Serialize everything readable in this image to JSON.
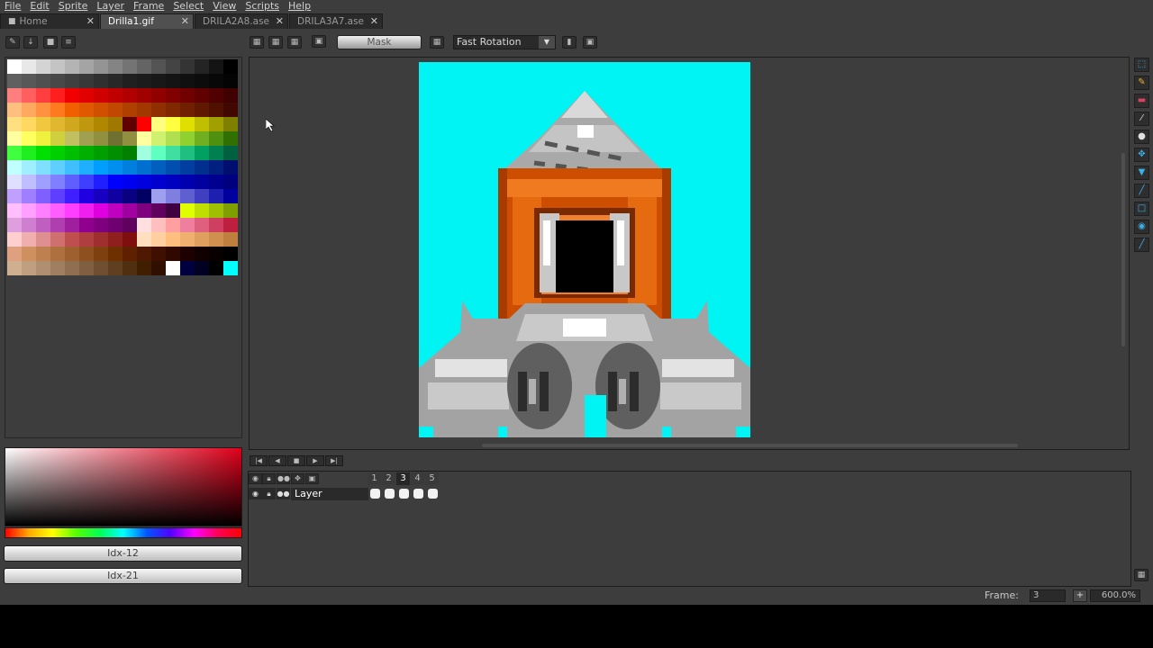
{
  "menu": [
    "File",
    "Edit",
    "Sprite",
    "Layer",
    "Frame",
    "Select",
    "View",
    "Scripts",
    "Help"
  ],
  "tabs": [
    {
      "label": "Home",
      "active": false
    },
    {
      "label": "Drilla1.gif",
      "active": true
    },
    {
      "label": "DRILA2A8.ase",
      "active": false
    },
    {
      "label": "DRILA3A7.ase",
      "active": false
    }
  ],
  "toolbar": {
    "mask_label": "Mask",
    "rotation_value": "Fast Rotation",
    "icons": [
      "grid-icon",
      "pixel-grid-icon",
      "symmetry-icon",
      "image-icon"
    ]
  },
  "palette": {
    "colors": [
      "#ffffff",
      "#e8e8e8",
      "#d4d4d4",
      "#c4c4c4",
      "#b4b4b4",
      "#a4a4a4",
      "#949494",
      "#848484",
      "#747474",
      "#646464",
      "#545454",
      "#444444",
      "#343434",
      "#242424",
      "#141414",
      "#000000",
      "#606060",
      "#585858",
      "#505050",
      "#484848",
      "#404040",
      "#383838",
      "#303030",
      "#282828",
      "#202020",
      "#1c1c1c",
      "#181818",
      "#141414",
      "#101010",
      "#0c0c0c",
      "#080808",
      "#040404",
      "#ff7f7f",
      "#ff5f5f",
      "#ff3f3f",
      "#ff1f1f",
      "#f00000",
      "#e00000",
      "#d00000",
      "#c00000",
      "#b00000",
      "#a00000",
      "#900000",
      "#800000",
      "#700000",
      "#600000",
      "#500000",
      "#400000",
      "#ffbf7f",
      "#ffa85f",
      "#ff913f",
      "#ff7a1f",
      "#f06000",
      "#e05800",
      "#d05000",
      "#c04800",
      "#b04000",
      "#a03800",
      "#903000",
      "#802800",
      "#702000",
      "#601800",
      "#501000",
      "#400800",
      "#ffdf7f",
      "#ffd85f",
      "#f0c83f",
      "#e0b82f",
      "#d0a81f",
      "#c0980f",
      "#b08800",
      "#a07800",
      "#600000",
      "#ff0000",
      "#ffff7f",
      "#ffff3f",
      "#e0e000",
      "#c0c000",
      "#a0a000",
      "#808000",
      "#ffff9f",
      "#ffff5f",
      "#f0f03f",
      "#d0d03f",
      "#c0c060",
      "#a0a050",
      "#909040",
      "#707030",
      "#909040",
      "#ffff9f",
      "#d0f070",
      "#b0e050",
      "#90d030",
      "#70b020",
      "#509010",
      "#307000",
      "#3fff3f",
      "#1fef1f",
      "#00df00",
      "#00cf00",
      "#00bf00",
      "#00af00",
      "#009f00",
      "#008f00",
      "#007f00",
      "#9fffdf",
      "#5fffbf",
      "#3fdf9f",
      "#1fbf7f",
      "#00a060",
      "#008050",
      "#006040",
      "#bfffff",
      "#9fefff",
      "#7fdfff",
      "#5fcfff",
      "#3fbfff",
      "#1fafff",
      "#009fff",
      "#008fef",
      "#007fdf",
      "#006fcf",
      "#005fbf",
      "#004faf",
      "#003f9f",
      "#002f8f",
      "#001f7f",
      "#000f6f",
      "#dfdfff",
      "#bfbfff",
      "#9f9fff",
      "#7f7fff",
      "#5f5fff",
      "#3f3fff",
      "#1f1fff",
      "#0000ff",
      "#0000ef",
      "#0000df",
      "#0000cf",
      "#0000bf",
      "#0000af",
      "#00009f",
      "#00008f",
      "#00007f",
      "#bf9fff",
      "#9f7fff",
      "#7f5fff",
      "#5f3fff",
      "#3f1fff",
      "#2000e0",
      "#1800c0",
      "#1000a0",
      "#080080",
      "#000060",
      "#9f9fef",
      "#7f7fdf",
      "#5f5fcf",
      "#3f3fbf",
      "#1f1faf",
      "#00009f",
      "#ffbfff",
      "#ff9fff",
      "#ff7fff",
      "#ff5fff",
      "#ff3fff",
      "#ef1fef",
      "#df00df",
      "#bf00bf",
      "#9f009f",
      "#7f007f",
      "#5f005f",
      "#3f003f",
      "#dfff00",
      "#bfdf00",
      "#9fbf00",
      "#7f9f00",
      "#df9fdf",
      "#cf7fcf",
      "#bf5fbf",
      "#af3faf",
      "#9f1f9f",
      "#8f008f",
      "#7f007f",
      "#6f006f",
      "#5f005f",
      "#ffdfdf",
      "#ffbfbf",
      "#ff9f9f",
      "#ef7f9f",
      "#df5f7f",
      "#cf3f5f",
      "#bf1f3f",
      "#ffcfcf",
      "#efafaf",
      "#df8f8f",
      "#cf6f6f",
      "#bf4f4f",
      "#af3f3f",
      "#9f2f2f",
      "#8f1f1f",
      "#7f0f0f",
      "#ffdfbf",
      "#ffcf9f",
      "#ffbf7f",
      "#efaf6f",
      "#df9f5f",
      "#cf8f4f",
      "#bf7f3f",
      "#dfa07f",
      "#cf905f",
      "#bf804f",
      "#af703f",
      "#9f602f",
      "#8f5020",
      "#7f4010",
      "#6f3000",
      "#5f2000",
      "#4f1800",
      "#3f1000",
      "#2f0800",
      "#1f0000",
      "#100000",
      "#080000",
      "#000000",
      "#cfaf8f",
      "#bf9f7f",
      "#af8f6f",
      "#9f7f5f",
      "#8f6f4f",
      "#7f5f3f",
      "#6f4f2f",
      "#5f3f1f",
      "#4f2f0f",
      "#3f1f00",
      "#2f0f00",
      "#ffffff",
      "#000040",
      "#000020",
      "#000000",
      "#00ffff",
      "#3d3d3d"
    ]
  },
  "color_picker": {
    "fg_label": "Idx-12",
    "bg_label": "Idx-21"
  },
  "timeline": {
    "frames": [
      "1",
      "2",
      "3",
      "4",
      "5"
    ],
    "active_frame": "3",
    "layer_name": "Layer"
  },
  "status": {
    "frame_label": "Frame:",
    "frame_value": "3",
    "zoom_button": "+",
    "zoom_value": "600.0%"
  },
  "tools": [
    "marquee-icon",
    "pencil-icon",
    "eraser-icon",
    "eyedropper-icon",
    "zoom-icon",
    "move-icon",
    "paint-bucket-icon",
    "line-icon",
    "rectangle-icon",
    "blur-icon",
    "contour-icon"
  ]
}
